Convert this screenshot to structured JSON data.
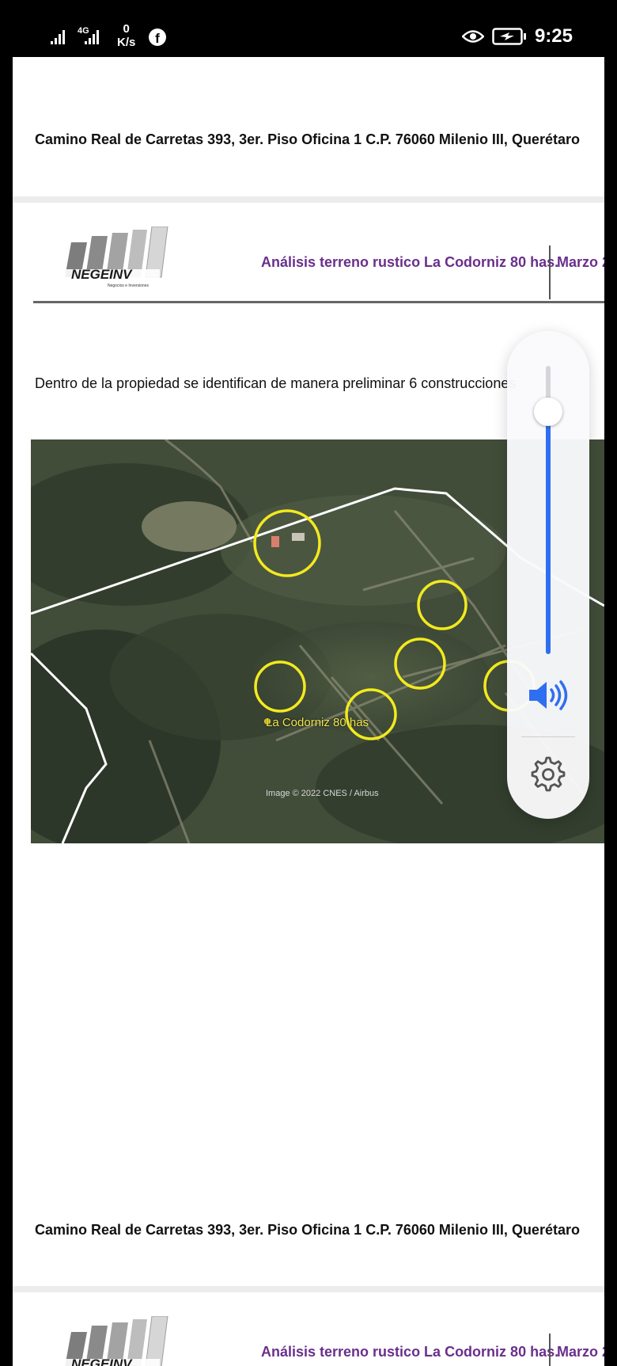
{
  "status_bar": {
    "network": "4G",
    "speed_value": "0",
    "speed_unit": "K/s",
    "app_icon": "facebook-icon",
    "time": "9:25"
  },
  "document": {
    "address": "Camino Real de Carretas 393, 3er. Piso Oficina 1 C.P. 76060 Milenio III, Querétaro",
    "header": {
      "logo_text": "NEGEINV",
      "logo_tagline": "Negocios e Inversiones",
      "title": "Análisis terreno rustico La Codorniz 80 has.",
      "date": "Marzo 2"
    },
    "body_text": "Dentro de la propiedad se identifican de manera preliminar 6 construcciones",
    "map": {
      "label": "La Codorniz  80 has",
      "credit": "Image © 2022 CNES / Airbus",
      "highlight_color": "#f2ea1e"
    }
  },
  "volume_panel": {
    "level": 0.84,
    "accent_color": "#2f6ef0",
    "speaker_icon": "speaker-volume-icon",
    "settings_icon": "gear-icon"
  }
}
